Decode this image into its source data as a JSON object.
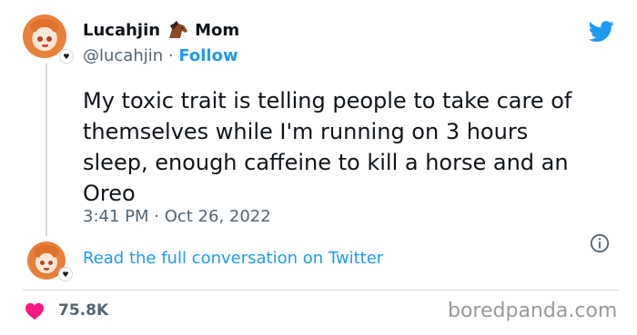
{
  "tweet": {
    "author_name": "Lucahjin",
    "author_name_suffix": "Mom",
    "handle": "@lucahjin",
    "separator": " · ",
    "follow_label": "Follow",
    "text_lines": [
      "My toxic trait is telling people to take care of",
      "themselves while I'm running on 3 hours",
      "sleep, enough caffeine to kill a horse and an",
      "Oreo"
    ],
    "time": "3:41 PM",
    "date": "Oct 26, 2022",
    "conversation_link": "Read the full conversation on Twitter",
    "likes": "75.8K"
  },
  "watermark": "boredpanda.com",
  "icons": {
    "brand": "twitter-bird-icon",
    "name_emoji": "horse-icon",
    "info": "info-icon",
    "like": "heart-icon"
  },
  "colors": {
    "accent": "#1d9bf0",
    "heart": "#f91880",
    "text": "#0f1419",
    "muted": "#536471"
  }
}
